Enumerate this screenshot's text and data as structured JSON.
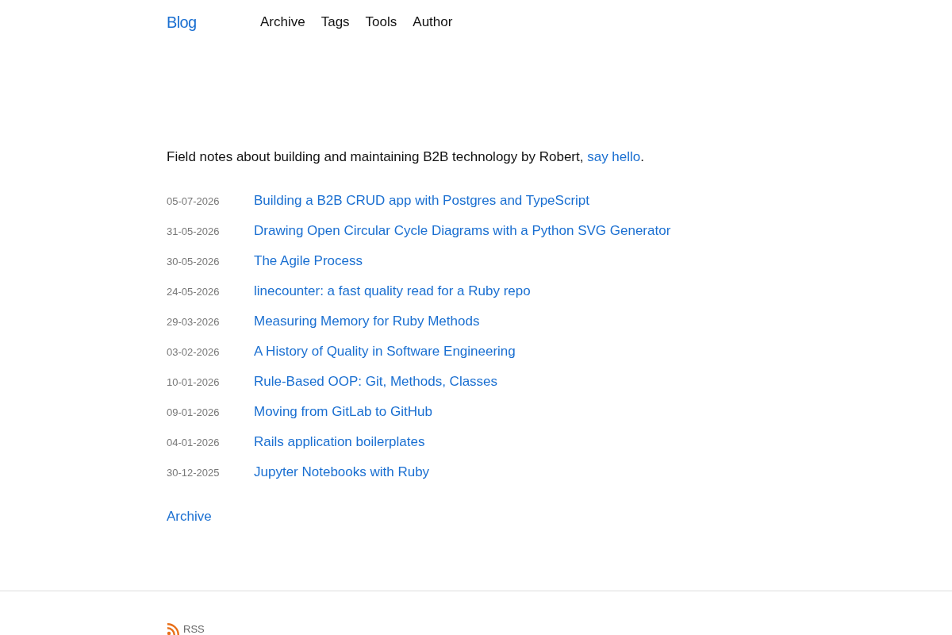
{
  "header": {
    "logo": "Blog",
    "nav": [
      "Archive",
      "Tags",
      "Tools",
      "Author"
    ]
  },
  "intro": {
    "text": "Field notes about building and maintaining B2B technology by Robert,",
    "link": "say hello",
    "after": "."
  },
  "posts": [
    {
      "date": "05-07-2026",
      "title": "Building a B2B CRUD app with Postgres and TypeScript"
    },
    {
      "date": "31-05-2026",
      "title": "Drawing Open Circular Cycle Diagrams with a Python SVG Generator"
    },
    {
      "date": "30-05-2026",
      "title": "The Agile Process"
    },
    {
      "date": "24-05-2026",
      "title": "linecounter: a fast quality read for a Ruby repo"
    },
    {
      "date": "29-03-2026",
      "title": "Measuring Memory for Ruby Methods"
    },
    {
      "date": "03-02-2026",
      "title": "A History of Quality in Software Engineering"
    },
    {
      "date": "10-01-2026",
      "title": "Rule-Based OOP: Git, Methods, Classes"
    },
    {
      "date": "09-01-2026",
      "title": "Moving from GitLab to GitHub"
    },
    {
      "date": "04-01-2026",
      "title": "Rails application boilerplates"
    },
    {
      "date": "30-12-2025",
      "title": "Jupyter Notebooks with Ruby"
    }
  ],
  "archive_link": "Archive",
  "footer": {
    "rss": "RSS"
  }
}
